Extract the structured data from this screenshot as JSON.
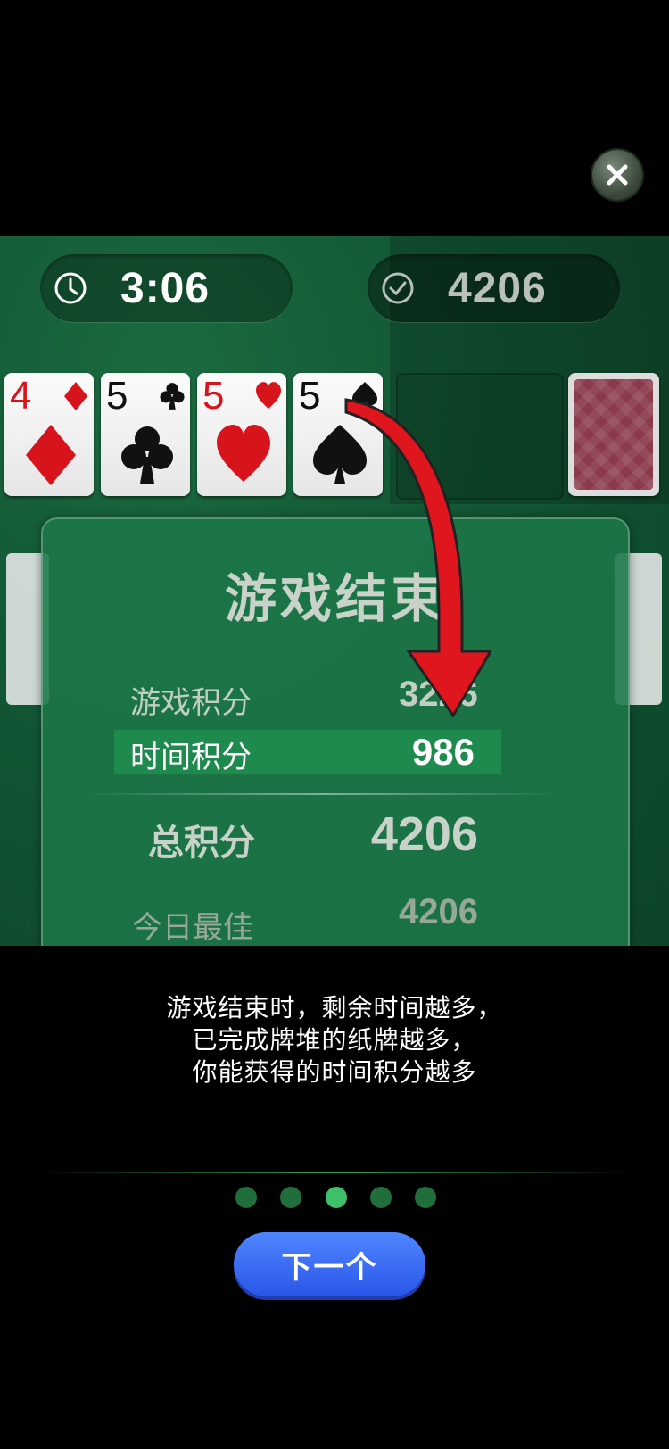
{
  "hud": {
    "timer": "3:06",
    "score": "4206"
  },
  "cards": [
    {
      "rank": "4",
      "suit": "diamond"
    },
    {
      "rank": "5",
      "suit": "club"
    },
    {
      "rank": "5",
      "suit": "heart"
    },
    {
      "rank": "5",
      "suit": "spade"
    }
  ],
  "result_panel": {
    "title": "游戏结束",
    "game_score_label": "游戏积分",
    "game_score_value": "3226",
    "time_score_label": "时间积分",
    "time_score_value": "986",
    "total_label": "总积分",
    "total_value": "4206",
    "best_label": "今日最佳",
    "best_value": "4206"
  },
  "caption": {
    "line1": "游戏结束时，剩余时间越多，",
    "line2": "已完成牌堆的纸牌越多，",
    "line3": "你能获得的时间积分越多"
  },
  "pagination": {
    "total": 5,
    "active_index": 2
  },
  "next_button": {
    "label": "下一个"
  },
  "colors": {
    "board_green": "#125634",
    "accent_blue": "#2a56e8",
    "active_dot": "#3ec06a",
    "arrow_red": "#e0161e"
  },
  "icons": {
    "close": "close-icon",
    "timer": "clock-icon",
    "score": "check-circle-icon"
  }
}
